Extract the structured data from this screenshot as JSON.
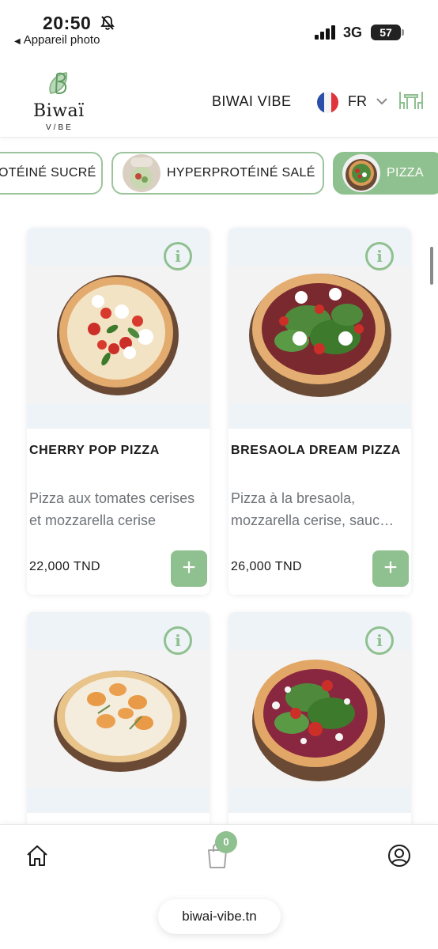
{
  "status_bar": {
    "time": "20:50",
    "back_label": "Appareil photo",
    "network": "3G",
    "battery": "57"
  },
  "header": {
    "logo_name": "Biwaï",
    "logo_sub": "V/BE",
    "brand_title": "BIWAI VIBE",
    "language": "FR",
    "icons": [
      "bell-slash-icon",
      "signal-icon",
      "flag-france-icon",
      "chevron-down-icon",
      "table-chairs-icon"
    ]
  },
  "categories": [
    {
      "label": "OTÉINÉ SUCRÉ",
      "active": false
    },
    {
      "label": "HYPERPROTÉINÉ SALÉ",
      "active": false
    },
    {
      "label": "PIZZA",
      "active": true
    }
  ],
  "products": [
    {
      "name": "CHERRY POP PIZZA",
      "description": "Pizza aux tomates cerises et mozzarella cerise",
      "price": "22,000 TND"
    },
    {
      "name": "BRESAOLA DREAM PIZZA",
      "description": "Pizza à la bresaola, mozzarella cerise, sauce balsamique",
      "price": "26,000 TND"
    },
    {
      "name": "",
      "description": "",
      "price": ""
    },
    {
      "name": "",
      "description": "",
      "price": ""
    }
  ],
  "bottom_nav": {
    "cart_count": "0",
    "url": "biwai-vibe.tn",
    "icons": [
      "home-icon",
      "shopping-bag-icon",
      "user-icon"
    ]
  },
  "colors": {
    "accent": "#8fc08f",
    "image_bg": "#eef3f8",
    "muted_text": "#6e7378",
    "wood": "#6b4a35"
  }
}
